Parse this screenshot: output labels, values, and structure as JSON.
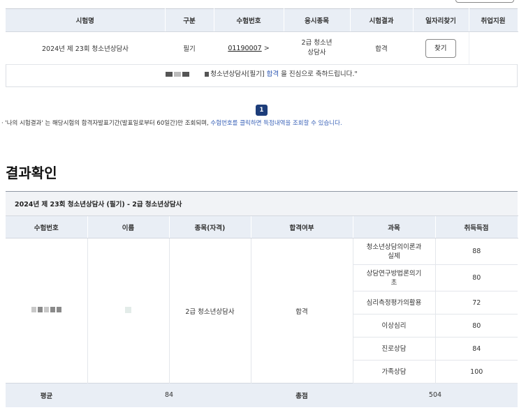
{
  "top_table": {
    "headers": [
      "시험명",
      "구분",
      "수험번호",
      "응시종목",
      "시험결과",
      "일자리찾기",
      "취업지원"
    ],
    "row": {
      "exam_name": "2024년 제 23회 청소년상담사",
      "type": "필기",
      "exam_number": "01190007",
      "exam_number_arrow": ">",
      "category": "2급 청소년상담사",
      "result": "합격",
      "find_button": "찾기",
      "support": ""
    }
  },
  "congrats": {
    "prefix": "청소년상담사[필기]",
    "pass_word": "합격",
    "suffix": "을 진심으로 축하드립니다.\""
  },
  "pagination": {
    "current": "1"
  },
  "notice": {
    "part1": "· '나의 시험결과' 는 해당시험의 합격자발표기간(발표일로부터 60일간)만 조회되며,",
    "part2": "수험번호를 클릭하면 득점내역을 조회할 수 있습니다."
  },
  "section_title": "결과확인",
  "result_table": {
    "caption": "2024년 제 23회 청소년상담사 (필기) - 2급 청소년상담사",
    "headers": [
      "수험번호",
      "이름",
      "종목(자격)",
      "합격여부",
      "과목",
      "취득득점"
    ],
    "category": "2급 청소년상담사",
    "pass_status": "합격",
    "subjects": [
      {
        "name": "청소년상담의이론과 실제",
        "score": "88"
      },
      {
        "name": "상담연구방법론의기 초",
        "score": "80"
      },
      {
        "name": "심리측정평가의활용",
        "score": "72"
      },
      {
        "name": "이상심리",
        "score": "80"
      },
      {
        "name": "진로상담",
        "score": "84"
      },
      {
        "name": "가족상담",
        "score": "100"
      }
    ],
    "footer": {
      "average_label": "평균",
      "average_value": "84",
      "total_label": "총점",
      "total_value": "504"
    }
  },
  "colors": {
    "header_bg": "#e9eef5",
    "accent_blue": "#3b63b8",
    "pager_bg": "#1d3d7a"
  }
}
